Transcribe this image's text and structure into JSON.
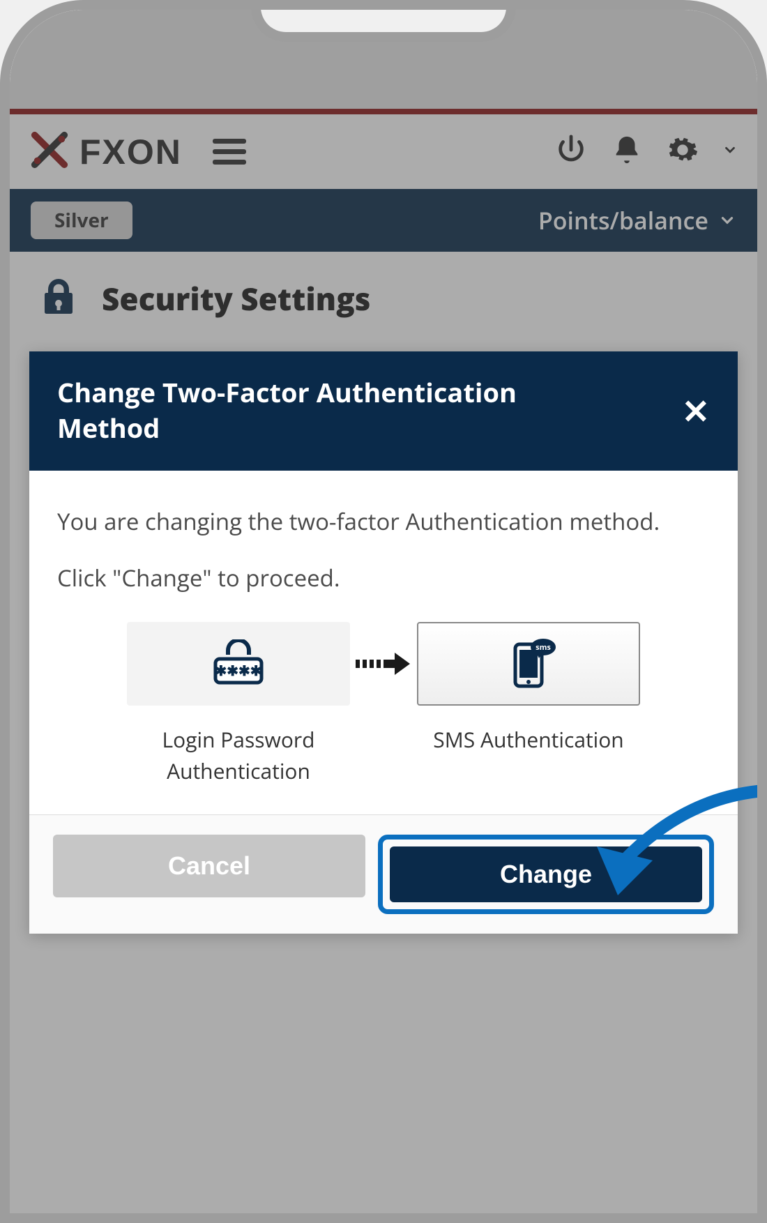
{
  "header": {
    "brand": "FXON",
    "points_label": "Points/balance"
  },
  "subbar": {
    "tier": "Silver"
  },
  "page": {
    "title": "Security Settings"
  },
  "dialog": {
    "title": "Change Two-Factor Authentication Method",
    "body_line1": "You are changing the two-factor Authentication method.",
    "body_line2": "Click \"Change\" to proceed.",
    "method_from": "Login Password Authentication",
    "method_to": "SMS Authentication",
    "cancel": "Cancel",
    "change": "Change"
  }
}
